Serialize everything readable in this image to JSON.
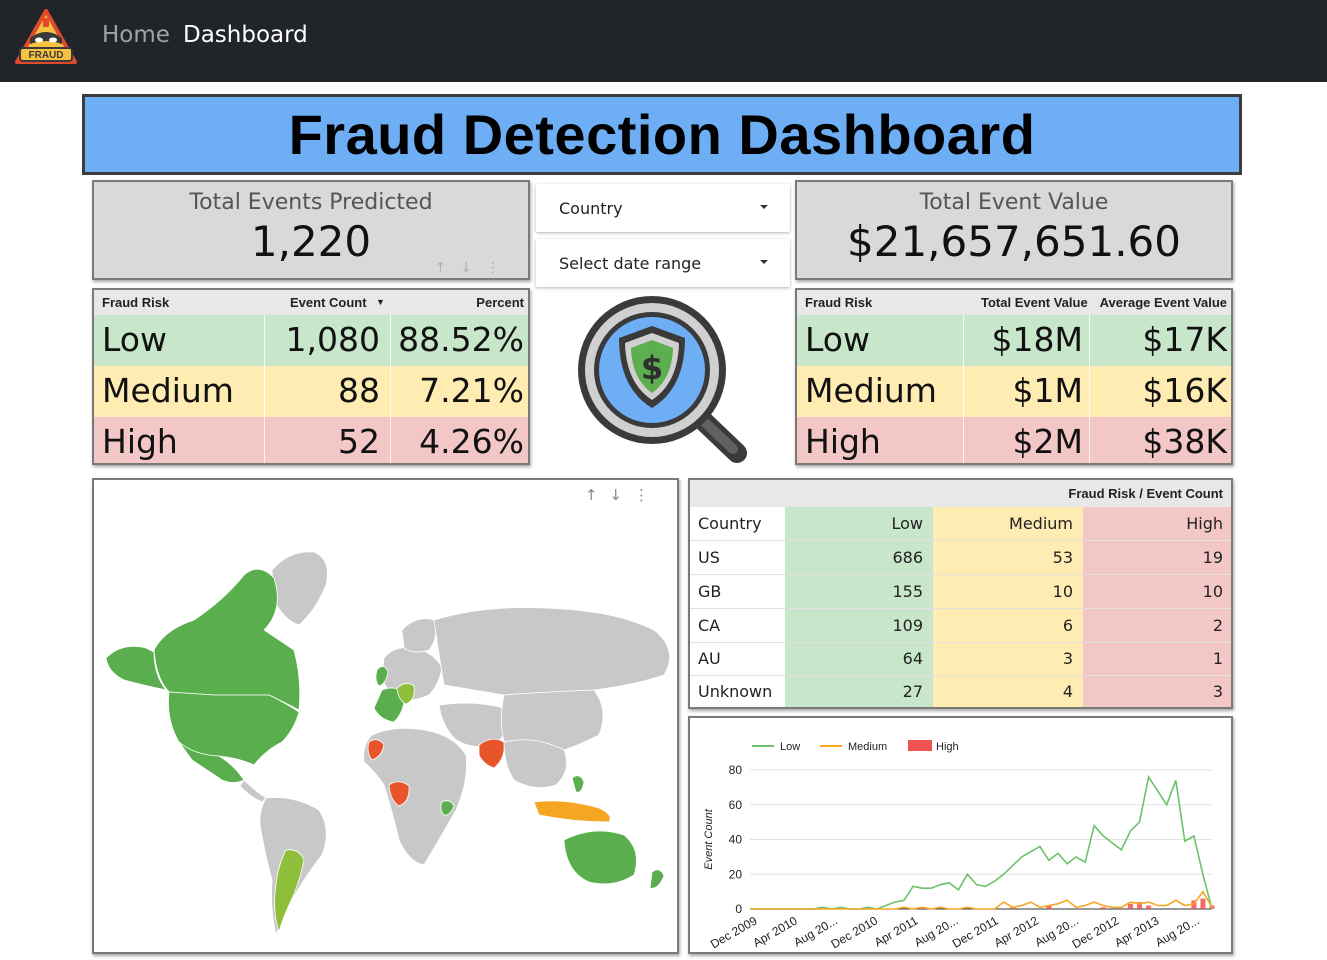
{
  "nav": {
    "logo_text": "FRAUD",
    "links": [
      "Home",
      "Dashboard"
    ]
  },
  "title": "Fraud Detection Dashboard",
  "scorecards": {
    "events": {
      "label": "Total Events Predicted",
      "value": "1,220"
    },
    "value": {
      "label": "Total Event Value",
      "value": "$21,657,651.60"
    }
  },
  "filters": {
    "country": "Country",
    "date": "Select date range"
  },
  "risk_counts": {
    "headers": [
      "Fraud Risk",
      "Event Count",
      "Percent"
    ],
    "rows": [
      {
        "risk": "Low",
        "count": "1,080",
        "percent": "88.52%"
      },
      {
        "risk": "Medium",
        "count": "88",
        "percent": "7.21%"
      },
      {
        "risk": "High",
        "count": "52",
        "percent": "4.26%"
      }
    ]
  },
  "risk_values": {
    "headers": [
      "Fraud Risk",
      "Total Event Value",
      "Average Event Value"
    ],
    "rows": [
      {
        "risk": "Low",
        "total": "$18M",
        "avg": "$17K"
      },
      {
        "risk": "Medium",
        "total": "$1M",
        "avg": "$16K"
      },
      {
        "risk": "High",
        "total": "$2M",
        "avg": "$38K"
      }
    ]
  },
  "country_table": {
    "title": "Fraud Risk / Event Count",
    "headers": [
      "Country",
      "Low",
      "Medium",
      "High"
    ],
    "rows": [
      {
        "country": "US",
        "low": "686",
        "medium": "53",
        "high": "19"
      },
      {
        "country": "GB",
        "low": "155",
        "medium": "10",
        "high": "10"
      },
      {
        "country": "CA",
        "low": "109",
        "medium": "6",
        "high": "2"
      },
      {
        "country": "AU",
        "low": "64",
        "medium": "3",
        "high": "1"
      },
      {
        "country": "Unknown",
        "low": "27",
        "medium": "4",
        "high": "3"
      }
    ]
  },
  "colors": {
    "low": "#c8e6c9",
    "medium": "#ffecb3",
    "high": "#f4c7c7",
    "banner": "#6daef5",
    "line_low": "#6cc26a",
    "line_medium": "#f5a623",
    "bar_high": "#ef5350"
  },
  "chart_data": {
    "type": "line",
    "ylabel": "Event Count",
    "xlabel": "",
    "ylim": [
      0,
      80
    ],
    "yticks": [
      0,
      20,
      40,
      60,
      80
    ],
    "xtick_labels": [
      "Dec 2009",
      "Apr 2010",
      "Aug 20...",
      "Dec 2010",
      "Apr 2011",
      "Aug 20...",
      "Dec 2011",
      "Apr 2012",
      "Aug 20...",
      "Dec 2012",
      "Apr 2013",
      "Aug 20..."
    ],
    "legend": [
      "Low",
      "Medium",
      "High"
    ],
    "legend_position": "top-left",
    "grid": true,
    "series": [
      {
        "name": "Low",
        "type": "line",
        "values": [
          0,
          0,
          0,
          0,
          0,
          0,
          0,
          0,
          1,
          0,
          1,
          0,
          0,
          1,
          0,
          2,
          4,
          5,
          13,
          12,
          12,
          14,
          15,
          11,
          20,
          14,
          13,
          16,
          20,
          25,
          30,
          33,
          36,
          28,
          32,
          26,
          30,
          27,
          48,
          42,
          38,
          34,
          45,
          50,
          76,
          68,
          60,
          74,
          39,
          42,
          20,
          0
        ]
      },
      {
        "name": "Medium",
        "type": "line",
        "values": [
          0,
          0,
          0,
          0,
          0,
          0,
          0,
          0,
          0,
          0,
          0,
          0,
          0,
          0,
          0,
          0,
          0,
          1,
          0,
          1,
          0,
          1,
          0,
          0,
          1,
          0,
          0,
          0,
          4,
          1,
          2,
          4,
          1,
          2,
          3,
          5,
          1,
          2,
          4,
          2,
          1,
          1,
          4,
          3,
          4,
          2,
          2,
          5,
          2,
          3,
          10,
          1
        ]
      },
      {
        "name": "High",
        "type": "bar",
        "values": [
          0,
          0,
          0,
          0,
          0,
          0,
          0,
          0,
          0,
          0,
          0,
          0,
          0,
          0,
          0,
          0,
          0,
          0,
          0,
          1,
          0,
          0,
          0,
          0,
          0,
          0,
          0,
          0,
          0,
          1,
          0,
          0,
          0,
          2,
          0,
          0,
          0,
          0,
          0,
          1,
          0,
          0,
          3,
          4,
          2,
          0,
          0,
          0,
          0,
          5,
          6,
          2
        ]
      }
    ]
  }
}
